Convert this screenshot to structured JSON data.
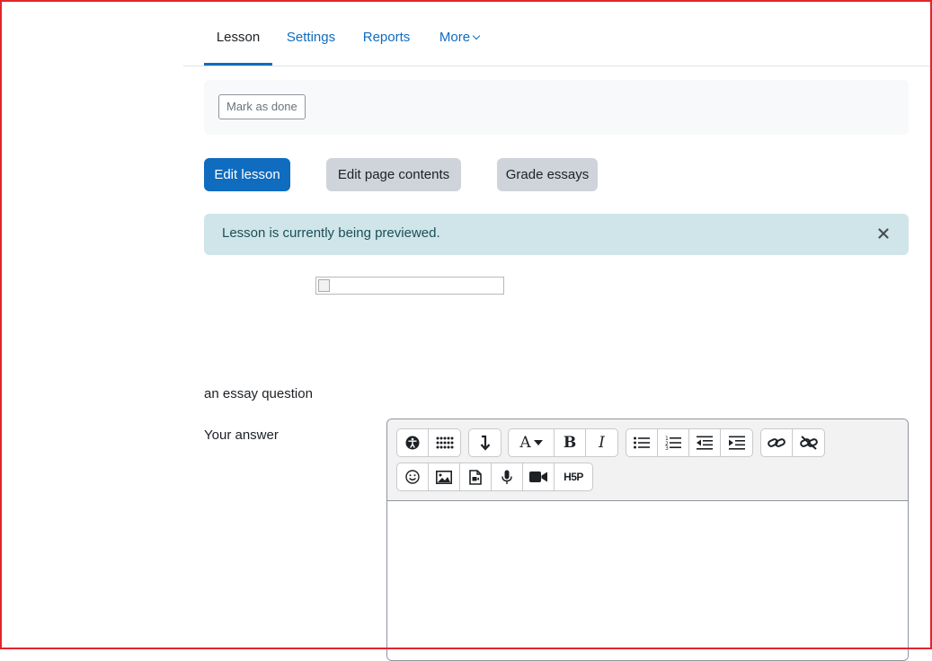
{
  "tabs": {
    "lesson": "Lesson",
    "settings": "Settings",
    "reports": "Reports",
    "more": "More"
  },
  "completion": {
    "mark_done": "Mark as done"
  },
  "actions": {
    "edit_lesson": "Edit lesson",
    "edit_page_contents": "Edit page contents",
    "grade_essays": "Grade essays"
  },
  "alert": {
    "message": "Lesson is currently being previewed."
  },
  "question": {
    "text": "an essay question",
    "answer_label": "Your answer"
  },
  "editor": {
    "toolbar_row1": [
      [
        "accessibility-checker-icon",
        "screenreader-helper-icon"
      ],
      [
        "show-more-buttons-icon"
      ],
      [
        "paragraph-styles-icon",
        "bold-icon",
        "italic-icon"
      ],
      [
        "unordered-list-icon",
        "ordered-list-icon",
        "outdent-icon",
        "indent-icon"
      ],
      [
        "link-icon",
        "unlink-icon"
      ]
    ],
    "toolbar_row2": [
      [
        "emoji-icon",
        "image-icon",
        "media-icon",
        "record-audio-icon",
        "record-video-icon",
        "h5p-icon"
      ]
    ],
    "h5p_label": "H5P",
    "bold_label": "B",
    "italic_label": "I",
    "font_label": "A",
    "value": ""
  },
  "colors": {
    "primary": "#0f6cbf",
    "secondary": "#ced4da",
    "alert_bg": "#cfe5e9",
    "frame": "#e3262b"
  }
}
